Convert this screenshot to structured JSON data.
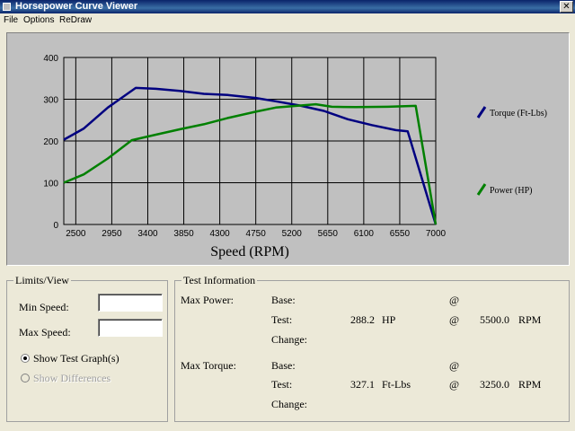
{
  "window": {
    "title": "Horsepower Curve Viewer"
  },
  "menu": [
    "File",
    "Options",
    "ReDraw"
  ],
  "chart_data": {
    "type": "line",
    "xlabel": "Speed (RPM)",
    "xlim": [
      2350,
      7000
    ],
    "ylim": [
      0,
      400
    ],
    "x_ticks": [
      2500,
      2950,
      3400,
      3850,
      4300,
      4750,
      5200,
      5650,
      6100,
      6550,
      7000
    ],
    "y_ticks": [
      0,
      100,
      200,
      300,
      400
    ],
    "grid": true,
    "legend_position": "right",
    "series": [
      {
        "name": "Torque (Ft-Lbs)",
        "color": "#000080",
        "points": [
          [
            2350,
            203
          ],
          [
            2600,
            230
          ],
          [
            2900,
            280
          ],
          [
            3250,
            327
          ],
          [
            3500,
            325
          ],
          [
            3800,
            320
          ],
          [
            4100,
            313
          ],
          [
            4400,
            310
          ],
          [
            4750,
            303
          ],
          [
            5000,
            295
          ],
          [
            5300,
            285
          ],
          [
            5600,
            272
          ],
          [
            5900,
            252
          ],
          [
            6200,
            238
          ],
          [
            6500,
            226
          ],
          [
            6650,
            223
          ],
          [
            7000,
            0
          ]
        ]
      },
      {
        "name": "Power (HP)",
        "color": "#008000",
        "points": [
          [
            2350,
            100
          ],
          [
            2600,
            120
          ],
          [
            2900,
            158
          ],
          [
            3200,
            202
          ],
          [
            3500,
            215
          ],
          [
            3800,
            228
          ],
          [
            4100,
            240
          ],
          [
            4400,
            255
          ],
          [
            4750,
            270
          ],
          [
            5000,
            280
          ],
          [
            5500,
            288
          ],
          [
            5700,
            282
          ],
          [
            6000,
            281
          ],
          [
            6400,
            282
          ],
          [
            6750,
            284
          ],
          [
            7000,
            0
          ]
        ]
      }
    ]
  },
  "limits": {
    "legend": "Limits/View",
    "min_speed_label": "Min Speed:",
    "max_speed_label": "Max Speed:",
    "min_speed_value": "",
    "max_speed_value": "",
    "show_test_label": "Show Test Graph(s)",
    "show_diff_label": "Show Differences"
  },
  "test_info": {
    "legend": "Test Information",
    "max_power_label": "Max Power:",
    "max_torque_label": "Max Torque:",
    "base_label": "Base:",
    "test_label": "Test:",
    "change_label": "Change:",
    "at": "@",
    "power_test_value": "288.2",
    "power_unit": "HP",
    "power_rpm": "5500.0",
    "torque_test_value": "327.1",
    "torque_unit": "Ft-Lbs",
    "torque_rpm": "3250.0",
    "rpm_unit": "RPM"
  }
}
